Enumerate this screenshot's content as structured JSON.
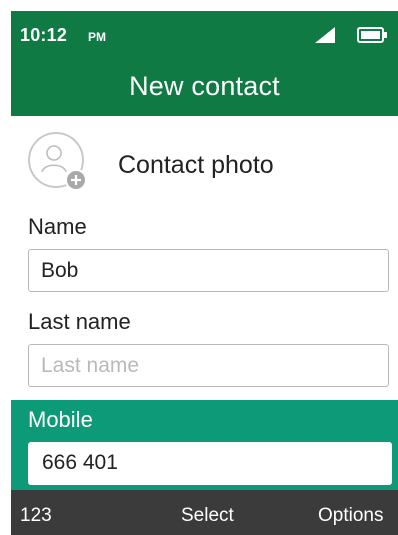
{
  "status_bar": {
    "time": "10:12",
    "ampm": "PM",
    "icons": [
      "signal-icon",
      "battery-icon"
    ]
  },
  "header": {
    "title": "New contact"
  },
  "photo": {
    "label": "Contact photo",
    "icon": "avatar-add-icon"
  },
  "fields": {
    "name": {
      "label": "Name",
      "value": "Bob"
    },
    "last_name": {
      "label": "Last name",
      "value": "",
      "placeholder": "Last name"
    },
    "mobile": {
      "label": "Mobile",
      "value": "666 401"
    }
  },
  "softkeys": {
    "left": "123",
    "center": "Select",
    "right": "Options"
  },
  "colors": {
    "header_green": "#107a45",
    "selection_teal": "#0d9a78",
    "softkey_bar": "#3b3b3b"
  }
}
